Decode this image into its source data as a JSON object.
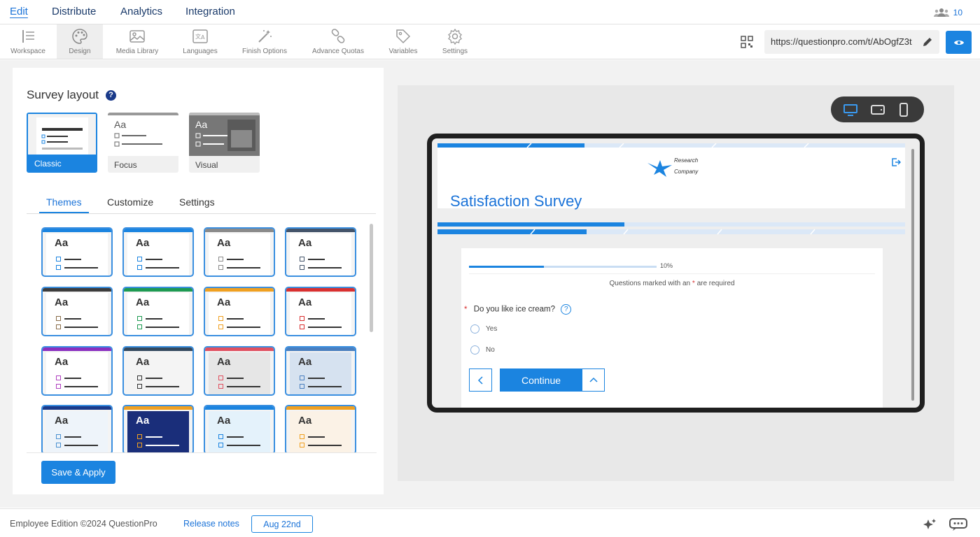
{
  "top_nav": {
    "tabs": [
      {
        "label": "Edit",
        "active": true
      },
      {
        "label": "Distribute"
      },
      {
        "label": "Analytics"
      },
      {
        "label": "Integration"
      }
    ],
    "users_icon": "users-icon",
    "users_count": "10"
  },
  "toolbar": {
    "items": [
      {
        "label": "Workspace",
        "icon": "workspace-icon"
      },
      {
        "label": "Design",
        "icon": "palette-icon",
        "active": true
      },
      {
        "label": "Media Library",
        "icon": "image-icon"
      },
      {
        "label": "Languages",
        "icon": "translate-icon"
      },
      {
        "label": "Finish Options",
        "icon": "magic-wand-icon"
      },
      {
        "label": "Advance Quotas",
        "icon": "link-icon"
      },
      {
        "label": "Variables",
        "icon": "tag-icon"
      },
      {
        "label": "Settings",
        "icon": "gear-icon"
      }
    ],
    "survey_url": "https://questionpro.com/t/AbOgfZ3t",
    "qr_icon": "qr-code-icon",
    "edit_icon": "pencil-icon",
    "preview_icon": "eye-icon"
  },
  "design": {
    "survey_layout_label": "Survey layout",
    "help_icon": "?",
    "layouts": [
      {
        "label": "Classic",
        "selected": true
      },
      {
        "label": "Focus"
      },
      {
        "label": "Visual"
      }
    ],
    "subtabs": [
      {
        "label": "Themes",
        "active": true
      },
      {
        "label": "Customize"
      },
      {
        "label": "Settings"
      }
    ],
    "theme_sample_text": "Aa",
    "themes": [
      {
        "accent": "#1b84e0",
        "box": "#1b84e0",
        "bg": "#ffffff"
      },
      {
        "accent": "#1b84e0",
        "box": "#1b84e0",
        "bg": "#ffffff"
      },
      {
        "accent": "#8a8a8a",
        "box": "#8a8a8a",
        "bg": "#ffffff"
      },
      {
        "accent": "#44546a",
        "box": "#44546a",
        "bg": "#ffffff"
      },
      {
        "accent": "#3c3c3c",
        "box": "#8a6d4a",
        "bg": "#ffffff"
      },
      {
        "accent": "#1e9a52",
        "box": "#1e9a52",
        "bg": "#ffffff"
      },
      {
        "accent": "#f0a020",
        "box": "#f0a020",
        "bg": "#ffffff"
      },
      {
        "accent": "#d93030",
        "box": "#d93030",
        "bg": "#ffffff"
      },
      {
        "accent": "#8a2fc0",
        "box": "#b040c0",
        "bg": "#ffffff"
      },
      {
        "accent": "#34495e",
        "box": "#333333",
        "bg": "#f4f4f4"
      },
      {
        "accent": "#e05060",
        "box": "#e05060",
        "bg": "#e6e6e6"
      },
      {
        "accent": "#4a7fbf",
        "box": "#4a7fbf",
        "bg": "#d6e2f0"
      },
      {
        "accent": "#1a3a8a",
        "box": "#4a90d0",
        "bg": "#eef4fa"
      },
      {
        "accent": "#f0a020",
        "box": "#f0a020",
        "bg": "#1a2e7a"
      },
      {
        "accent": "#1b84e0",
        "box": "#1b84e0",
        "bg": "#e4f2fb"
      },
      {
        "accent": "#f0a020",
        "box": "#f0a020",
        "bg": "#fbf2e6"
      }
    ],
    "save_apply_label": "Save & Apply"
  },
  "preview": {
    "device_icons": [
      "desktop-icon",
      "tablet-icon",
      "mobile-icon"
    ],
    "logo_text_line1": "Research",
    "logo_text_line2": "Company",
    "exit_icon": "exit-icon",
    "survey_title": "Satisfaction Survey",
    "progress_fraction": 0.4,
    "progress_label": "10%",
    "required_note_prefix": "Questions marked with an",
    "required_star": "*",
    "required_note_suffix": "are required",
    "question_text": "Do you like ice cream?",
    "options": [
      "Yes",
      "No"
    ],
    "continue_label": "Continue",
    "accent_color": "#1b84e0"
  },
  "footer": {
    "edition": "Employee Edition ©2024 QuestionPro",
    "release_notes": "Release notes",
    "release_date": "Aug 22nd",
    "sparkle_icon": "sparkle-icon",
    "chat_icon": "chat-icon"
  }
}
